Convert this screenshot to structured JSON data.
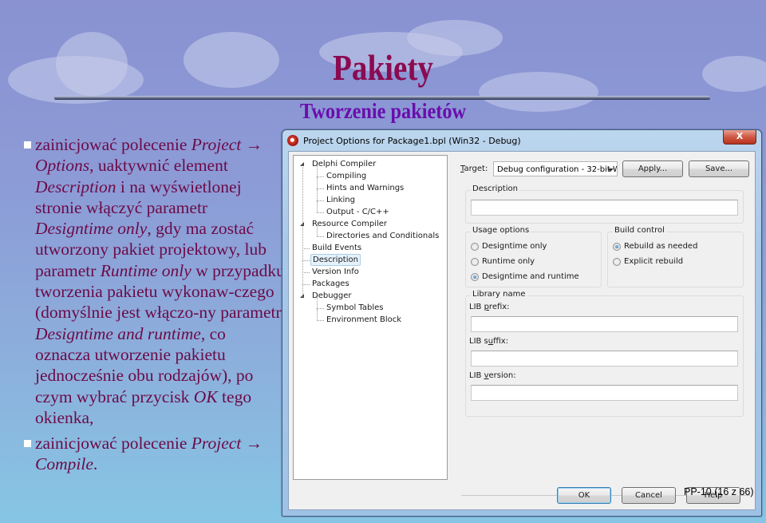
{
  "slide": {
    "title": "Pakiety",
    "subtitle": "Tworzenie pakietów",
    "page_number": "PP-10 (16 z 66)",
    "colors": {
      "title": "#8b0a50",
      "subtitle": "#6a0dad",
      "body_text": "#6c0a47"
    }
  },
  "bullets": [
    {
      "parts": [
        {
          "t": "zainicjować polecenie ",
          "i": false
        },
        {
          "t": "Project → Options",
          "i": true
        },
        {
          "t": ", uaktywnić element ",
          "i": false
        },
        {
          "t": "Description",
          "i": true
        },
        {
          "t": " i na wyświetlonej stronie włączyć parametr ",
          "i": false
        },
        {
          "t": "Designtime only",
          "i": true
        },
        {
          "t": ", gdy ma zostać utworzony pakiet projektowy, lub parametr ",
          "i": false
        },
        {
          "t": "Runtime only",
          "i": true
        },
        {
          "t": " w przypadku tworzenia pakietu wykonaw-czego (domyślnie jest włączo-ny parametr ",
          "i": false
        },
        {
          "t": "Designtime and runtime",
          "i": true
        },
        {
          "t": ", co oznacza utworzenie pakietu jednocześnie obu rodzajów), po czym wybrać przycisk ",
          "i": false
        },
        {
          "t": "OK",
          "i": true
        },
        {
          "t": " tego okienka,",
          "i": false
        }
      ]
    },
    {
      "parts": [
        {
          "t": "zainicjować polecenie ",
          "i": false
        },
        {
          "t": "Project → Compile",
          "i": true
        },
        {
          "t": ".",
          "i": false
        }
      ]
    }
  ],
  "dialog": {
    "title": "Project Options for Package1.bpl  (Win32 - Debug)",
    "close_label": "X",
    "tree": [
      {
        "label": "Delphi Compiler",
        "level": 0,
        "expanded": true
      },
      {
        "label": "Compiling",
        "level": 1
      },
      {
        "label": "Hints and Warnings",
        "level": 1
      },
      {
        "label": "Linking",
        "level": 1
      },
      {
        "label": "Output - C/C++",
        "level": 1
      },
      {
        "label": "Resource Compiler",
        "level": 0,
        "expanded": true
      },
      {
        "label": "Directories and Conditionals",
        "level": 1
      },
      {
        "label": "Build Events",
        "level": 0
      },
      {
        "label": "Description",
        "level": 0,
        "selected": true
      },
      {
        "label": "Version Info",
        "level": 0
      },
      {
        "label": "Packages",
        "level": 0
      },
      {
        "label": "Debugger",
        "level": 0,
        "expanded": true
      },
      {
        "label": "Symbol Tables",
        "level": 1
      },
      {
        "label": "Environment Block",
        "level": 1
      }
    ],
    "target_label": "Target:",
    "target_value": "Debug configuration - 32-bit W",
    "apply_label": "Apply...",
    "save_label": "Save...",
    "description_group": "Description",
    "description_value": "",
    "usage_group": "Usage options",
    "usage_options": [
      {
        "label": "Designtime only",
        "checked": false
      },
      {
        "label": "Runtime only",
        "checked": false
      },
      {
        "label": "Designtime and runtime",
        "checked": true
      }
    ],
    "build_group": "Build control",
    "build_options": [
      {
        "label": "Rebuild as needed",
        "checked": true
      },
      {
        "label": "Explicit rebuild",
        "checked": false
      }
    ],
    "library_group": "Library name",
    "lib_prefix_label": "LIB prefix:",
    "lib_prefix_value": "",
    "lib_suffix_label": "LIB suffix:",
    "lib_suffix_value": "",
    "lib_version_label": "LIB version:",
    "lib_version_value": "",
    "ok_label": "OK",
    "cancel_label": "Cancel",
    "help_label": "Help"
  }
}
